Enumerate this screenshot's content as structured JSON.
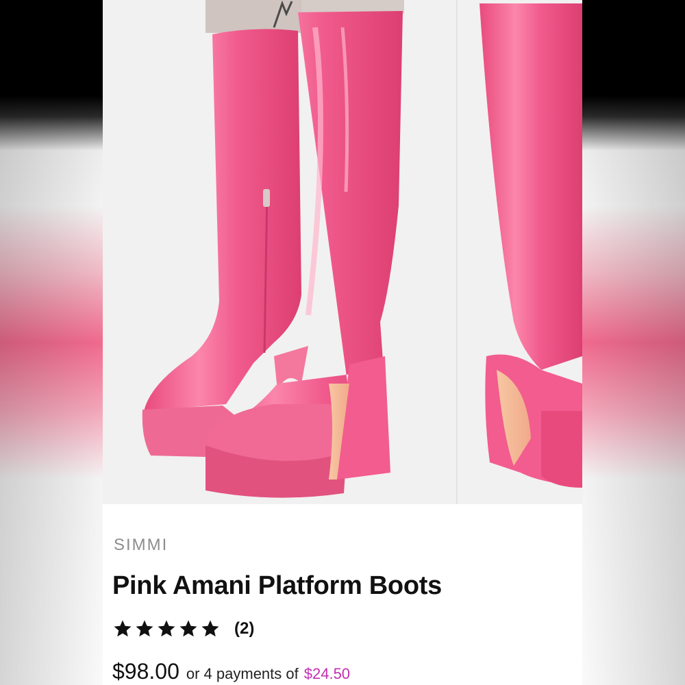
{
  "product": {
    "image_icon": "boots-photo",
    "brand": "SIMMI",
    "title": "Pink Amani Platform Boots",
    "rating": {
      "stars": 5,
      "max_stars": 5,
      "review_count": "(2)"
    },
    "price": "$98.00",
    "installment_text": "or 4 payments of",
    "installment_amount": "$24.50"
  },
  "colors": {
    "boot_pink": "#f25c8e",
    "installment_accent": "#c22fb0",
    "star": "#111111"
  }
}
